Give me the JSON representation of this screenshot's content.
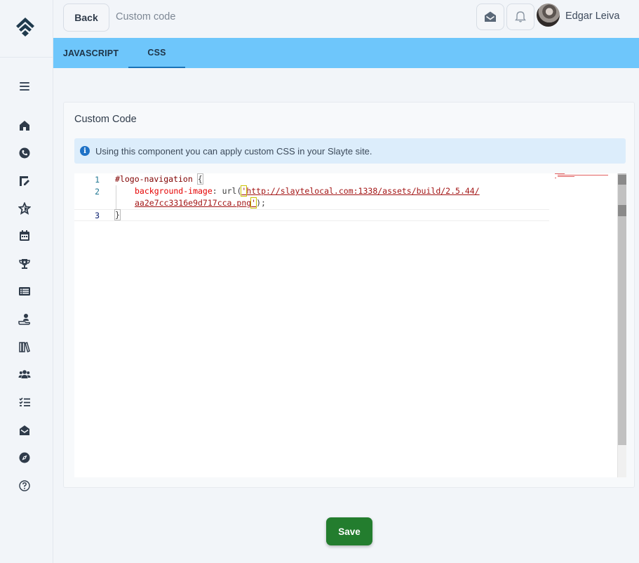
{
  "header": {
    "back_label": "Back",
    "title": "Custom code",
    "user_name": "Edgar Leiva"
  },
  "tabs": [
    {
      "label": "JAVASCRIPT",
      "active": false
    },
    {
      "label": "CSS",
      "active": true
    }
  ],
  "card": {
    "title": "Custom Code",
    "info_text": "Using this component you can apply custom CSS in your Slayte site."
  },
  "editor": {
    "line_numbers": [
      "1",
      "2",
      "3"
    ],
    "code": {
      "selector": "#logo-navigation",
      "open_brace": "{",
      "property": "background-image",
      "colon": ":",
      "fn": "url",
      "open_paren": "(",
      "quote_open": "'",
      "url_part1": "http://slaytelocal.com:1338/assets/build/2.5.44/",
      "url_part2": "aa2e7cc3316e9d717cca.png",
      "quote_close": "'",
      "close_paren": ")",
      "semicolon": ";",
      "close_brace": "}"
    }
  },
  "save_label": "Save",
  "sidebar": {
    "icons": [
      "home-icon",
      "phone-icon",
      "edit-icon",
      "star-icon",
      "calendar-icon",
      "trophy-icon",
      "list-icon",
      "user-hand-icon",
      "library-icon",
      "users-icon",
      "checklist-icon",
      "mail-open-icon",
      "compass-icon",
      "help-icon"
    ]
  },
  "colors": {
    "tabs_bg": "#6ec6fb",
    "save_bg": "#237d2e",
    "info_bg": "#dcedfb"
  }
}
